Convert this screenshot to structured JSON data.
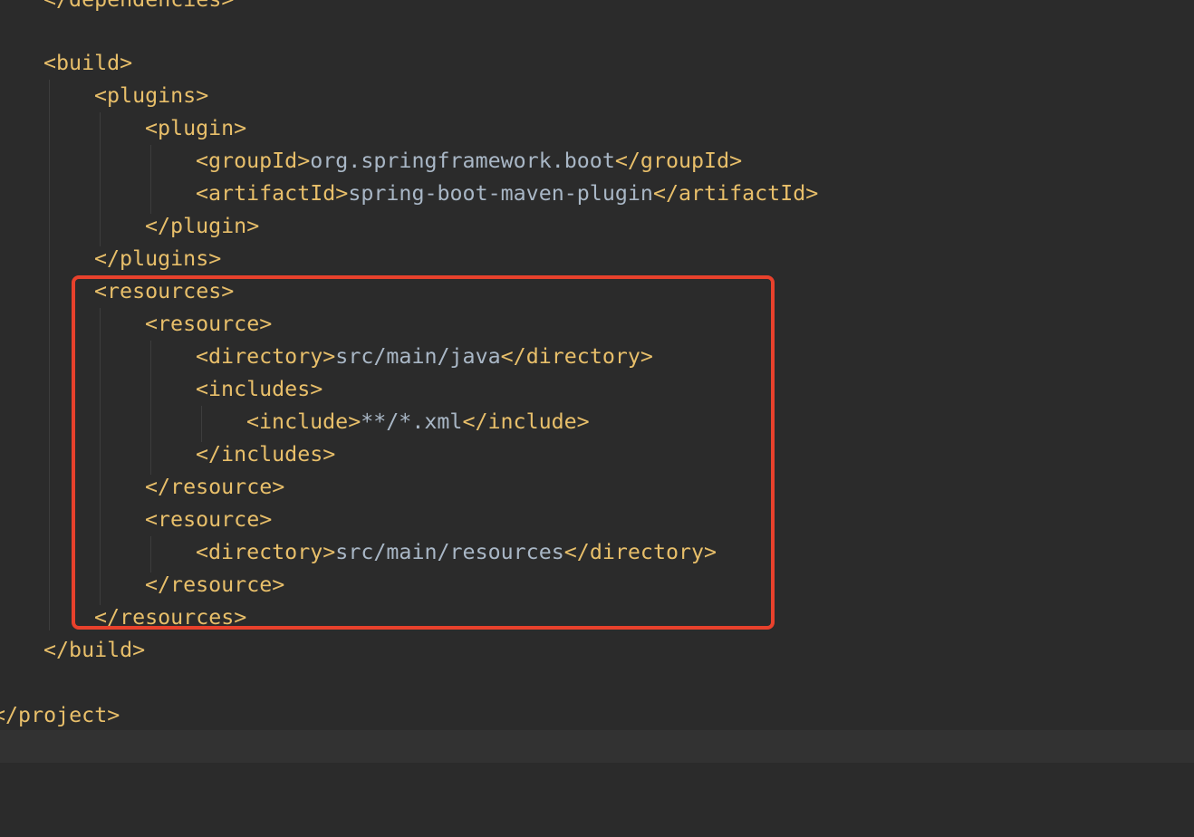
{
  "editor": {
    "colors": {
      "background": "#2b2b2b",
      "tag": "#e8bf6a",
      "text": "#a9b7c6",
      "highlight_border": "#e8412c",
      "current_line": "#323232"
    },
    "lines": [
      {
        "open": "</dependencies>",
        "text": "",
        "close": ""
      },
      {
        "open": "<build>",
        "text": "",
        "close": ""
      },
      {
        "open": "<plugins>",
        "text": "",
        "close": ""
      },
      {
        "open": "<plugin>",
        "text": "",
        "close": ""
      },
      {
        "open": "<groupId>",
        "text": "org.springframework.boot",
        "close": "</groupId>"
      },
      {
        "open": "<artifactId>",
        "text": "spring-boot-maven-plugin",
        "close": "</artifactId>"
      },
      {
        "open": "</plugin>",
        "text": "",
        "close": ""
      },
      {
        "open": "</plugins>",
        "text": "",
        "close": ""
      },
      {
        "open": "<resources>",
        "text": "",
        "close": ""
      },
      {
        "open": "<resource>",
        "text": "",
        "close": ""
      },
      {
        "open": "<directory>",
        "text": "src/main/java",
        "close": "</directory>"
      },
      {
        "open": "<includes>",
        "text": "",
        "close": ""
      },
      {
        "open": "<include>",
        "text": "**/*.xml",
        "close": "</include>"
      },
      {
        "open": "</includes>",
        "text": "",
        "close": ""
      },
      {
        "open": "</resource>",
        "text": "",
        "close": ""
      },
      {
        "open": "<resource>",
        "text": "",
        "close": ""
      },
      {
        "open": "<directory>",
        "text": "src/main/resources",
        "close": "</directory>"
      },
      {
        "open": "</resource>",
        "text": "",
        "close": ""
      },
      {
        "open": "</resources>",
        "text": "",
        "close": ""
      },
      {
        "open": "</build>",
        "text": "",
        "close": ""
      },
      {
        "open": "</project>",
        "text": "",
        "close": ""
      }
    ]
  }
}
